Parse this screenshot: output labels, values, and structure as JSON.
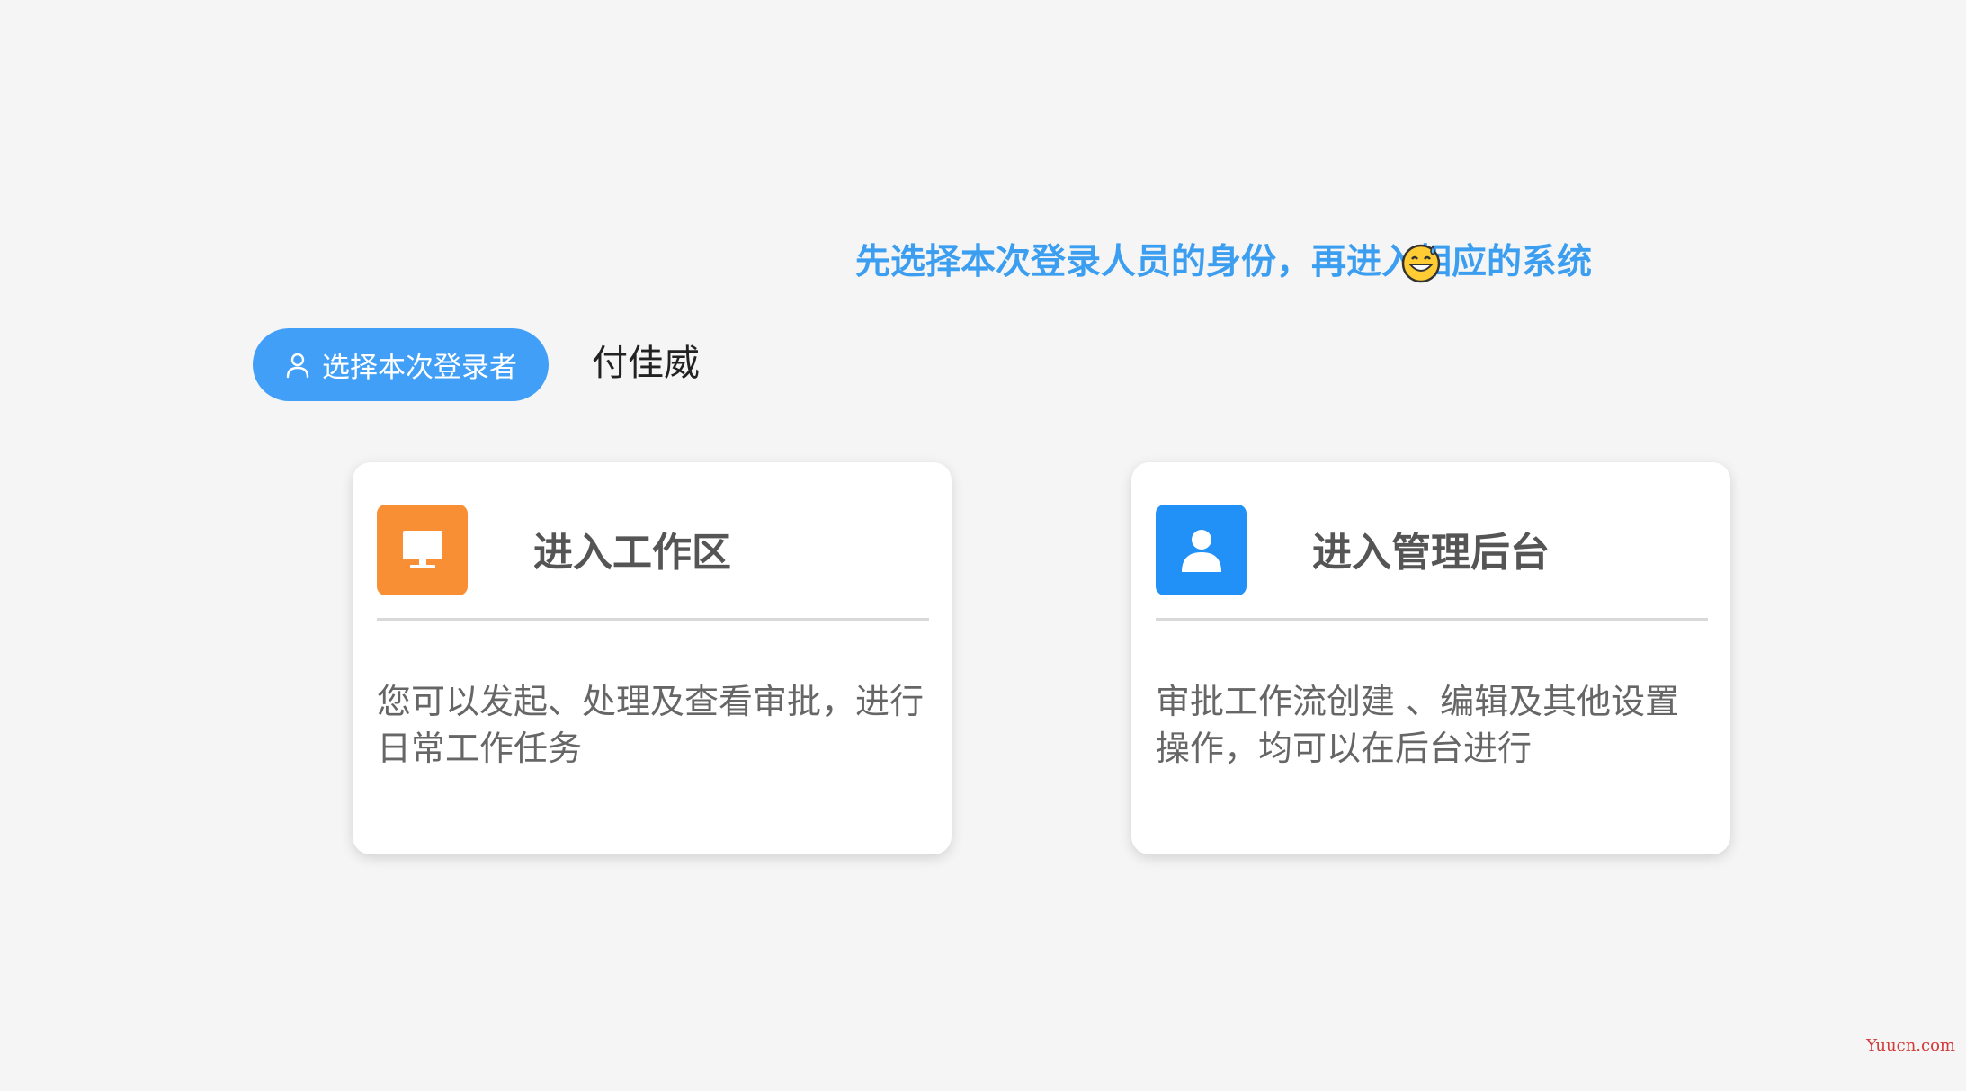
{
  "headline": {
    "text": "先选择本次登录人员的身份，再进入相应的系统",
    "emoji_icon": "grinning-sweat-emoji"
  },
  "login_selector": {
    "button_label": "选择本次登录者",
    "button_icon": "user-icon",
    "selected_name": "付佳威"
  },
  "cards": [
    {
      "title": "进入工作区",
      "icon": "monitor-icon",
      "icon_color": "#f98f35",
      "description": "您可以发起、处理及查看审批，进行日常工作任务"
    },
    {
      "title": "进入管理后台",
      "icon": "admin-user-icon",
      "icon_color": "#2190f7",
      "description": "审批工作流创建 、编辑及其他设置操作，均可以在后台进行"
    }
  ],
  "watermark": "Yuucn.com",
  "colors": {
    "background": "#f5f5f5",
    "accent_blue": "#3c9ef0",
    "button_blue": "#419ff7",
    "orange": "#f98f35"
  }
}
